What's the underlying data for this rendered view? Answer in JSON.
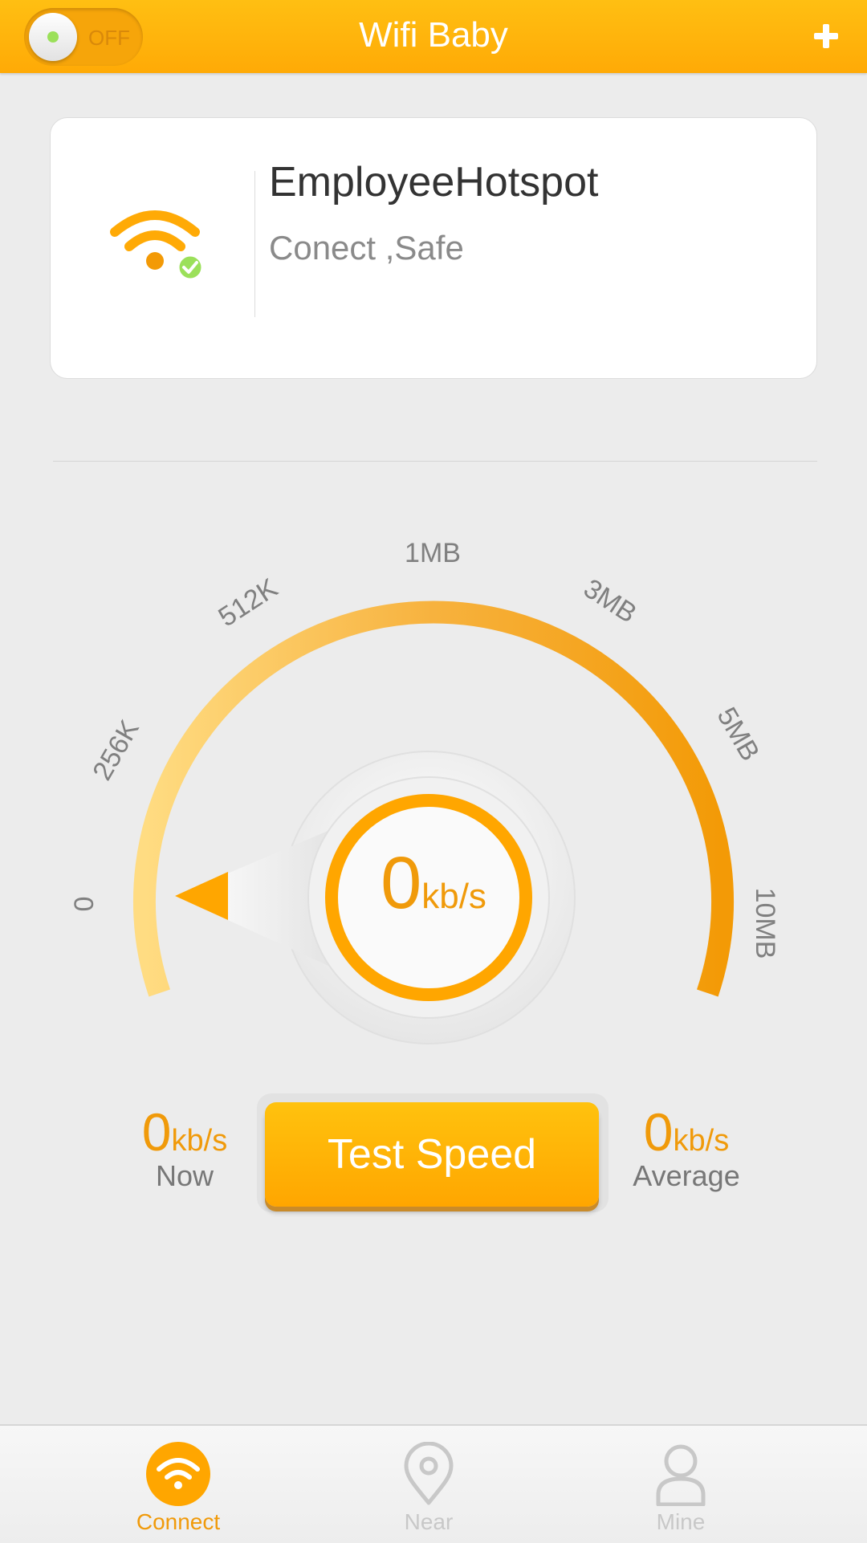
{
  "header": {
    "title": "Wifi Baby",
    "toggle_label": "OFF",
    "add_icon": "plus-icon"
  },
  "network_card": {
    "name": "EmployeeHotspot",
    "status": "Conect ,Safe",
    "icon": "wifi-connected-icon"
  },
  "gauge": {
    "scale_labels": [
      "0",
      "256K",
      "512K",
      "1MB",
      "3MB",
      "5MB",
      "10MB"
    ],
    "current_value": "0",
    "current_unit": "kb/s",
    "needle_value": 0
  },
  "stats": {
    "now": {
      "value": "0",
      "unit": "kb/s",
      "label": "Now"
    },
    "average": {
      "value": "0",
      "unit": "kb/s",
      "label": "Average"
    }
  },
  "actions": {
    "test_speed_label": "Test Speed"
  },
  "bottom_nav": {
    "items": [
      {
        "label": "Connect",
        "icon": "wifi-icon",
        "active": true
      },
      {
        "label": "Near",
        "icon": "location-pin-icon",
        "active": false
      },
      {
        "label": "Mine",
        "icon": "user-icon",
        "active": false
      }
    ]
  },
  "colors": {
    "accent": "#ffaa06",
    "accent_text": "#f09a0a",
    "inactive": "#c8c8c8"
  }
}
